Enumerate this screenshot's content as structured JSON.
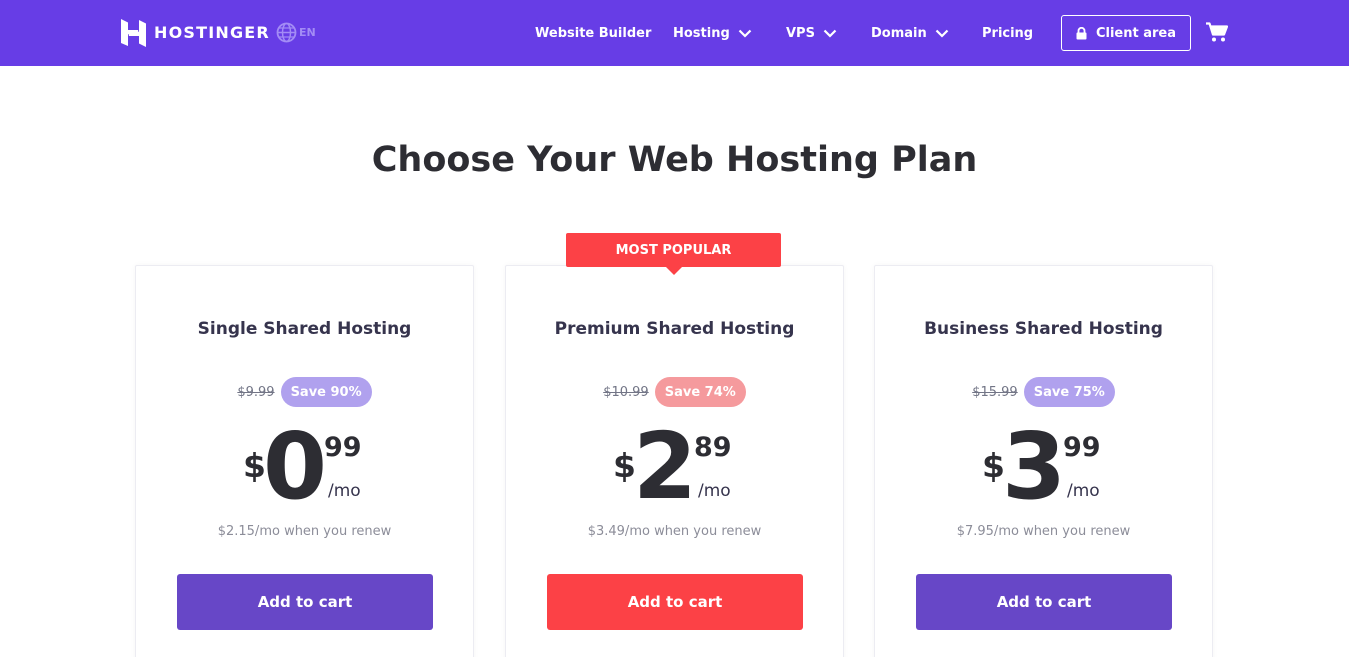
{
  "nav": {
    "brand": "HOSTINGER",
    "language": "EN",
    "items": [
      {
        "label": "Website Builder",
        "has_dropdown": false
      },
      {
        "label": "Hosting",
        "has_dropdown": true
      },
      {
        "label": "VPS",
        "has_dropdown": true
      },
      {
        "label": "Domain",
        "has_dropdown": true
      },
      {
        "label": "Pricing",
        "has_dropdown": false
      }
    ],
    "client_area": "Client area",
    "icons": [
      "hostinger-logo",
      "globe-icon",
      "chevron-down-icon",
      "lock-icon",
      "cart-icon"
    ]
  },
  "main": {
    "title": "Choose Your Web Hosting Plan",
    "popular_label": "MOST POPULAR",
    "plans": [
      {
        "name": "Single Shared Hosting",
        "old_price": "$9.99",
        "save": "Save 90%",
        "currency": "$",
        "price_whole": "0",
        "price_cents": "99",
        "per": "/mo",
        "renew": "$2.15/mo when you renew",
        "button": "Add to cart"
      },
      {
        "name": "Premium Shared Hosting",
        "old_price": "$10.99",
        "save": "Save 74%",
        "currency": "$",
        "price_whole": "2",
        "price_cents": "89",
        "per": "/mo",
        "renew": "$3.49/mo when you renew",
        "button": "Add to cart"
      },
      {
        "name": "Business Shared Hosting",
        "old_price": "$15.99",
        "save": "Save 75%",
        "currency": "$",
        "price_whole": "3",
        "price_cents": "99",
        "per": "/mo",
        "renew": "$7.95/mo when you renew",
        "button": "Add to cart"
      }
    ]
  },
  "colors": {
    "brand_purple": "#673de6",
    "button_purple": "#6747c7",
    "accent_red": "#fc4146",
    "save_purple": "#b0a1ee",
    "save_red": "#f59a9d",
    "heading": "#2d2d33"
  }
}
